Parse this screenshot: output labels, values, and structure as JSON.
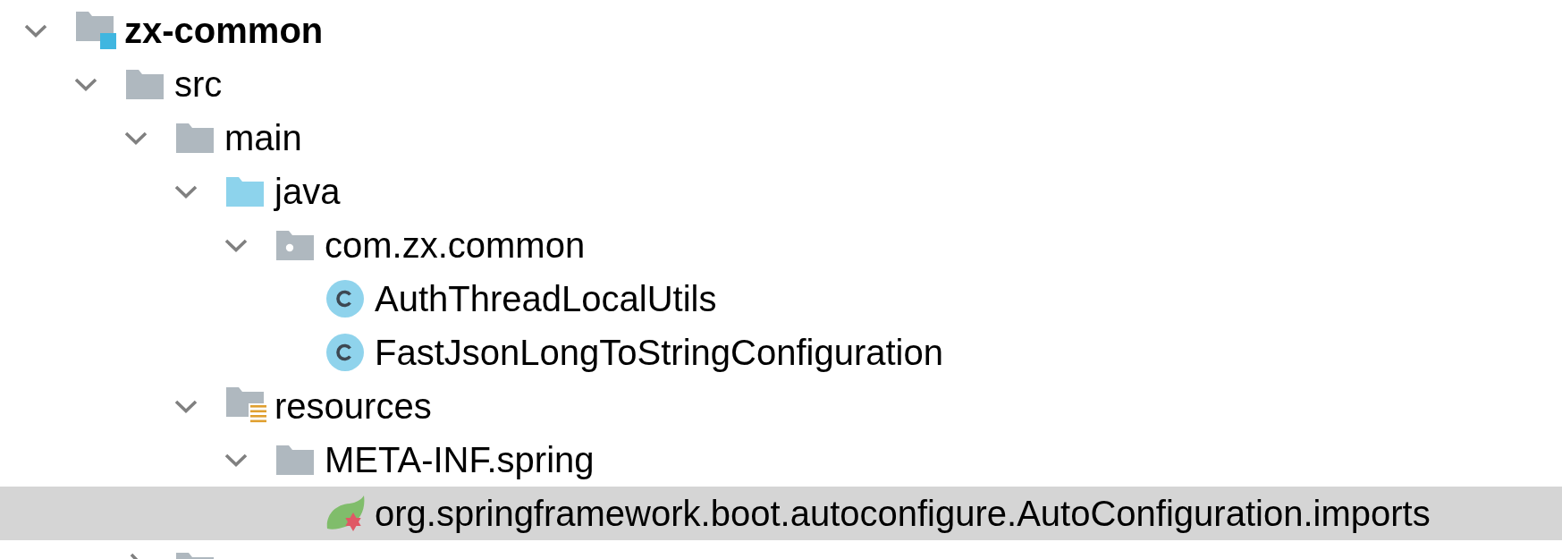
{
  "tree": {
    "items": [
      {
        "label": "zx-common",
        "kind": "module",
        "expanded": true,
        "selected": false,
        "children": [
          {
            "label": "src",
            "kind": "folder",
            "expanded": true,
            "selected": false,
            "children": [
              {
                "label": "main",
                "kind": "folder",
                "expanded": true,
                "selected": false,
                "children": [
                  {
                    "label": "java",
                    "kind": "source-folder",
                    "expanded": true,
                    "selected": false,
                    "children": [
                      {
                        "label": "com.zx.common",
                        "kind": "package",
                        "expanded": true,
                        "selected": false,
                        "children": [
                          {
                            "label": "AuthThreadLocalUtils",
                            "kind": "class",
                            "selected": false
                          },
                          {
                            "label": "FastJsonLongToStringConfiguration",
                            "kind": "class",
                            "selected": false
                          }
                        ]
                      }
                    ]
                  },
                  {
                    "label": "resources",
                    "kind": "resources-folder",
                    "expanded": true,
                    "selected": false,
                    "children": [
                      {
                        "label": "META-INF.spring",
                        "kind": "folder",
                        "expanded": true,
                        "selected": false,
                        "children": [
                          {
                            "label": "org.springframework.boot.autoconfigure.AutoConfiguration.imports",
                            "kind": "spring-file",
                            "selected": true
                          }
                        ]
                      }
                    ]
                  }
                ]
              },
              {
                "kind": "folder",
                "expanded": false,
                "selected": false
              }
            ]
          }
        ]
      }
    ]
  }
}
